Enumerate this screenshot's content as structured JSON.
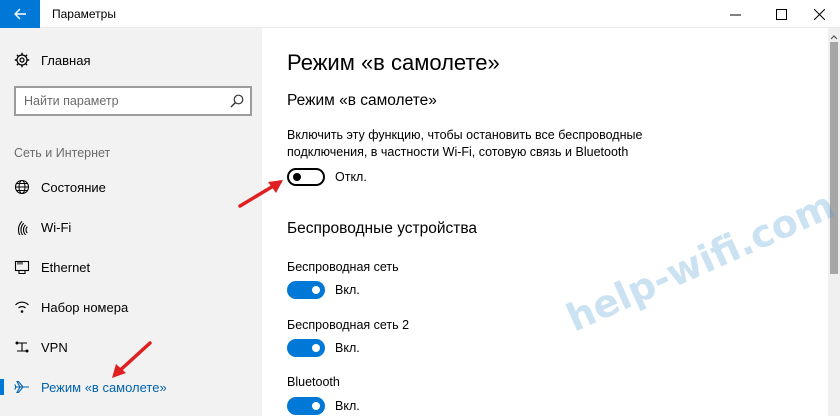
{
  "window": {
    "title": "Параметры"
  },
  "sidebar": {
    "home_label": "Главная",
    "search_placeholder": "Найти параметр",
    "section_label": "Сеть и Интернет",
    "items": [
      {
        "label": "Состояние",
        "icon": "globe-icon"
      },
      {
        "label": "Wi-Fi",
        "icon": "wifi-icon"
      },
      {
        "label": "Ethernet",
        "icon": "ethernet-icon"
      },
      {
        "label": "Набор номера",
        "icon": "dialup-icon"
      },
      {
        "label": "VPN",
        "icon": "vpn-icon"
      },
      {
        "label": "Режим «в самолете»",
        "icon": "airplane-icon",
        "active": true
      }
    ]
  },
  "main": {
    "page_title": "Режим «в самолете»",
    "airplane": {
      "title": "Режим «в самолете»",
      "description": "Включить эту функцию, чтобы остановить все беспроводные подключения, в частности Wi-Fi, сотовую связь и Bluetooth",
      "toggle_state": "Откл."
    },
    "wireless": {
      "title": "Беспроводные устройства",
      "devices": [
        {
          "label": "Беспроводная сеть",
          "state": "Вкл."
        },
        {
          "label": "Беспроводная сеть 2",
          "state": "Вкл."
        },
        {
          "label": "Bluetooth",
          "state": "Вкл."
        }
      ]
    }
  },
  "watermark": "help-wifi.com",
  "colors": {
    "accent": "#0078d7",
    "sidebar_bg": "#f2f2f2",
    "annotation_arrow": "#e02020"
  }
}
